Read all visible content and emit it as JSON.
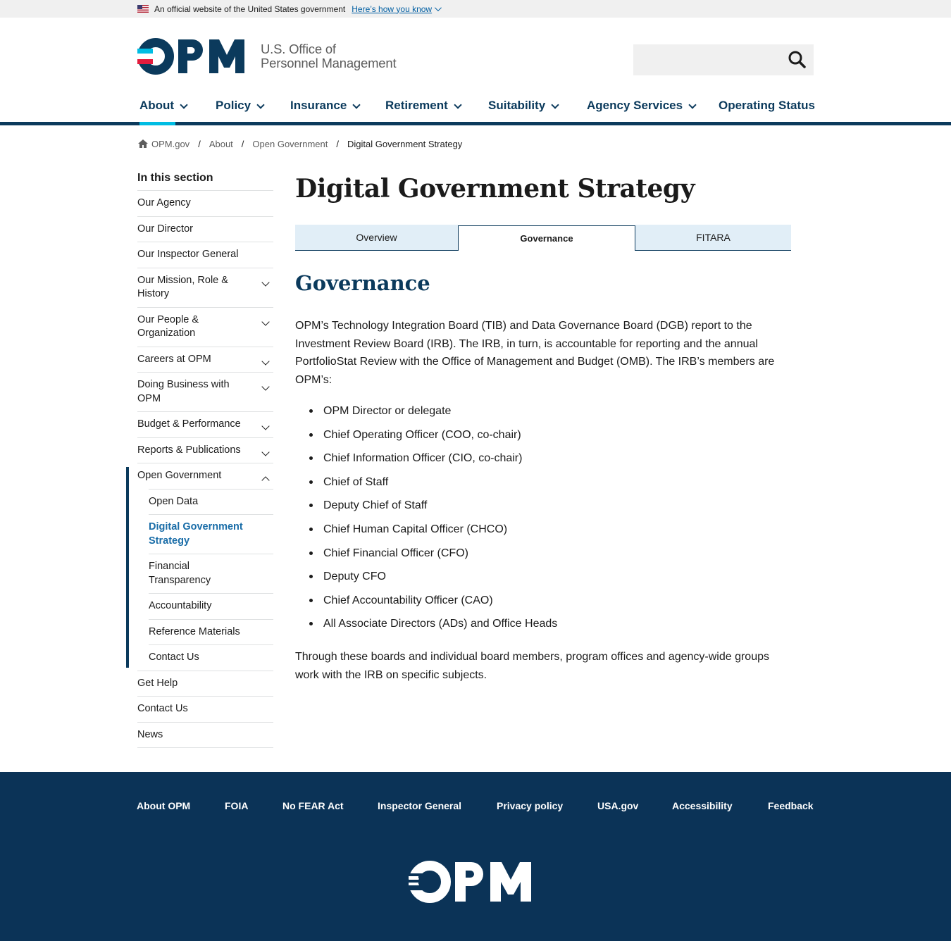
{
  "banner": {
    "text": "An official website of the United States government",
    "link": "Here’s how you know"
  },
  "header": {
    "logo_text_line1": "U.S. Office of",
    "logo_text_line2": "Personnel Management",
    "search_placeholder": ""
  },
  "nav": {
    "items": [
      {
        "label": "About",
        "dropdown": true
      },
      {
        "label": "Policy",
        "dropdown": true
      },
      {
        "label": "Insurance",
        "dropdown": true
      },
      {
        "label": "Retirement",
        "dropdown": true
      },
      {
        "label": "Suitability",
        "dropdown": true
      },
      {
        "label": "Agency Services",
        "dropdown": true
      },
      {
        "label": "Operating Status",
        "dropdown": false
      }
    ]
  },
  "breadcrumb": {
    "home": "OPM.gov",
    "sep": "/",
    "items": [
      "About",
      "Open Government"
    ],
    "current": "Digital Government Strategy"
  },
  "sidebar": {
    "title": "In this section",
    "items": [
      {
        "label": "Our Agency"
      },
      {
        "label": "Our Director"
      },
      {
        "label": "Our Inspector General"
      },
      {
        "label": "Our Mission, Role & History",
        "expandable": true
      },
      {
        "label": "Our People & Organization",
        "expandable": true
      },
      {
        "label": "Careers at OPM",
        "expandable": true
      },
      {
        "label": "Doing Business with OPM",
        "expandable": true
      },
      {
        "label": "Budget & Performance",
        "expandable": true
      },
      {
        "label": "Reports & Publications",
        "expandable": true
      },
      {
        "label": "Open Government",
        "expandable": true,
        "expanded": true
      }
    ],
    "sub_items": [
      {
        "label": "Open Data"
      },
      {
        "label": "Digital Government Strategy",
        "active": true
      },
      {
        "label": "Financial Transparency"
      },
      {
        "label": "Accountability"
      },
      {
        "label": "Reference Materials"
      },
      {
        "label": "Contact Us"
      }
    ],
    "after_items": [
      {
        "label": "Get Help"
      },
      {
        "label": "Contact Us"
      },
      {
        "label": "News"
      }
    ]
  },
  "main": {
    "title": "Digital Government Strategy",
    "tabs": [
      {
        "label": "Overview",
        "active": false
      },
      {
        "label": "Governance",
        "active": true
      },
      {
        "label": "FITARA",
        "active": false
      }
    ],
    "heading": "Governance",
    "paragraph1": "OPM’s Technology Integration Board (TIB) and Data Governance Board (DGB) report to the Investment Review Board (IRB). The IRB, in turn, is accountable for reporting and the annual PortfolioStat Review with the Office of Management and Budget (OMB). The IRB’s members are OPM’s:",
    "members": [
      "OPM Director or delegate",
      "Chief Operating Officer (COO, co-chair)",
      "Chief Information Officer (CIO, co-chair)",
      "Chief of Staff",
      "Deputy Chief of Staff",
      "Chief Human Capital Officer (CHCO)",
      "Chief Financial Officer (CFO)",
      "Deputy CFO",
      "Chief Accountability Officer (CAO)",
      "All Associate Directors (ADs) and Office Heads"
    ],
    "paragraph2": "Through these boards and individual board members, program offices and agency-wide groups work with the IRB on specific subjects."
  },
  "footer": {
    "links": [
      "About OPM",
      "FOIA",
      "No FEAR Act",
      "Inspector General",
      "Privacy policy",
      "USA.gov",
      "Accessibility",
      "Feedback"
    ]
  },
  "colors": {
    "navy": "#0b3a5c",
    "accent_cyan": "#00bde3",
    "accent_red": "#e31c3d",
    "link_blue": "#005ea2",
    "tab_bg": "#e1eef7",
    "footer_bg": "#0b3357"
  }
}
